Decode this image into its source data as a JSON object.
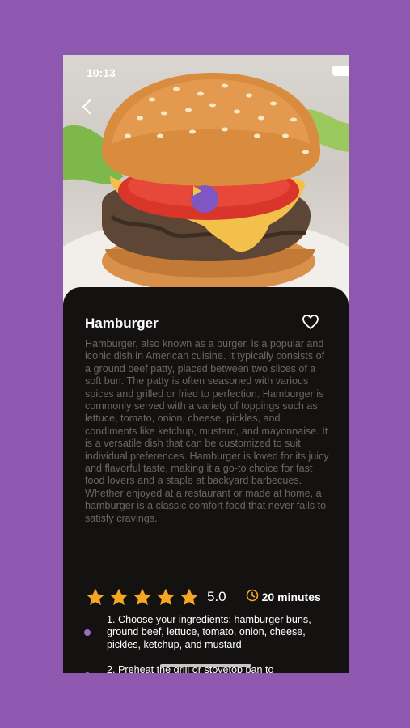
{
  "status_bar": {
    "time": "10:13"
  },
  "recipe": {
    "title": "Hamburger",
    "description": "Hamburger, also known as a burger, is a popular and iconic dish in American cuisine. It typically consists of a ground beef patty, placed between two slices of a soft bun. The patty is often seasoned with various spices and grilled or fried to perfection. Hamburger is commonly served with a variety of toppings such as lettuce, tomato, onion, cheese, pickles, and condiments like ketchup, mustard, and mayonnaise. It is a versatile dish that can be customized to suit individual preferences. Hamburger is loved for its juicy and flavorful taste, making it a go-to choice for fast food lovers and a staple at backyard barbecues. Whether enjoyed at a restaurant or made at home, a hamburger is a classic comfort food that never fails to satisfy cravings.",
    "rating": "5.0",
    "stars_filled": 5,
    "stars_total": 5,
    "cook_time": "20 minutes",
    "steps": [
      "1. Choose your ingredients: hamburger buns, ground beef, lettuce, tomato, onion, cheese, pickles, ketchup, and mustard",
      "2. Preheat the grill or stovetop pan to"
    ]
  },
  "icons": {
    "back": "chevron-left-icon",
    "favorite": "heart-outline-icon",
    "play": "play-icon",
    "star": "star-icon",
    "clock": "clock-icon",
    "wifi": "wifi-icon",
    "battery": "battery-icon"
  },
  "colors": {
    "background": "#8e58b0",
    "card": "#141111",
    "accent": "#7e57c2",
    "star": "#f5a623",
    "description_text": "#6b6767",
    "step_dot": "#9b6cc4"
  }
}
